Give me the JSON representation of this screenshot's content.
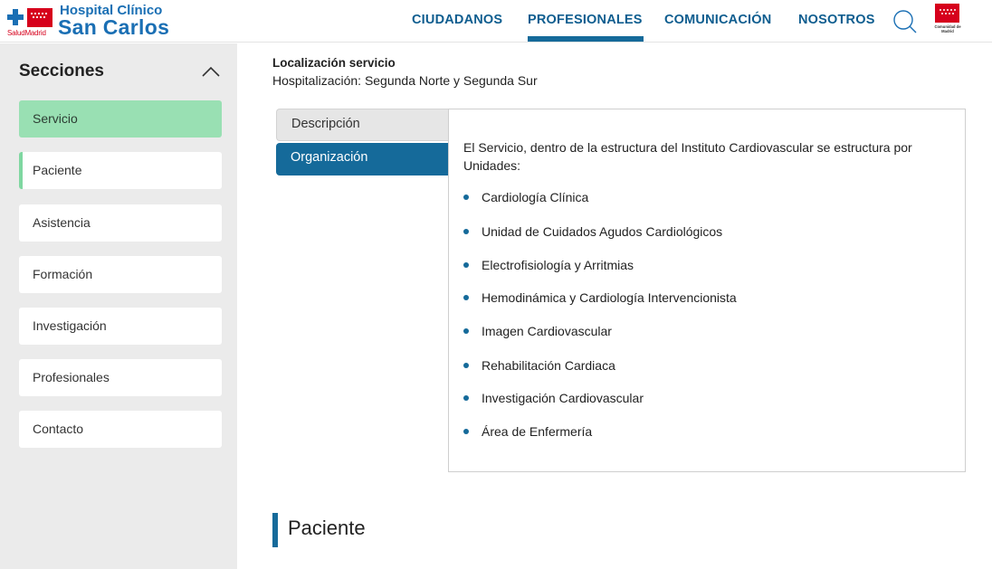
{
  "header": {
    "logo": {
      "subbrand": "SaludMadrid",
      "line1": "Hospital Clínico",
      "line2": "San Carlos"
    },
    "nav": [
      "CIUDADANOS",
      "PROFESIONALES",
      "COMUNICACIÓN",
      "NOSOTROS"
    ],
    "active_nav": "PROFESIONALES",
    "search_icon": "search-icon",
    "region_logo_text": "Comunidad de Madrid",
    "colors": {
      "brand_blue": "#1a6fb4",
      "nav_blue": "#0e5d8f",
      "accent_red": "#d6001c"
    }
  },
  "sidebar": {
    "title": "Secciones",
    "items": [
      "Servicio",
      "Paciente",
      "Asistencia",
      "Formación",
      "Investigación",
      "Profesionales",
      "Contacto"
    ],
    "active_item": "Servicio",
    "active_color": "#99e0b3"
  },
  "location": {
    "title": "Localización servicio",
    "value": "Hospitalización: Segunda Norte y Segunda Sur"
  },
  "tabs": {
    "items": [
      "Descripción",
      "Organización"
    ],
    "active": "Organización",
    "active_color": "#156a9a"
  },
  "panel": {
    "intro": "El Servicio, dentro de la estructura del Instituto Cardiovascular se estructura por Unidades:",
    "units": [
      "Cardiología Clínica",
      "Unidad de Cuidados Agudos Cardiológicos",
      "Electrofisiología y Arritmias",
      "Hemodinámica y Cardiología Intervencionista",
      "Imagen Cardiovascular",
      "Rehabilitación Cardiaca",
      "Investigación Cardiovascular",
      "Área de Enfermería"
    ]
  },
  "next_section": {
    "title": "Paciente"
  }
}
